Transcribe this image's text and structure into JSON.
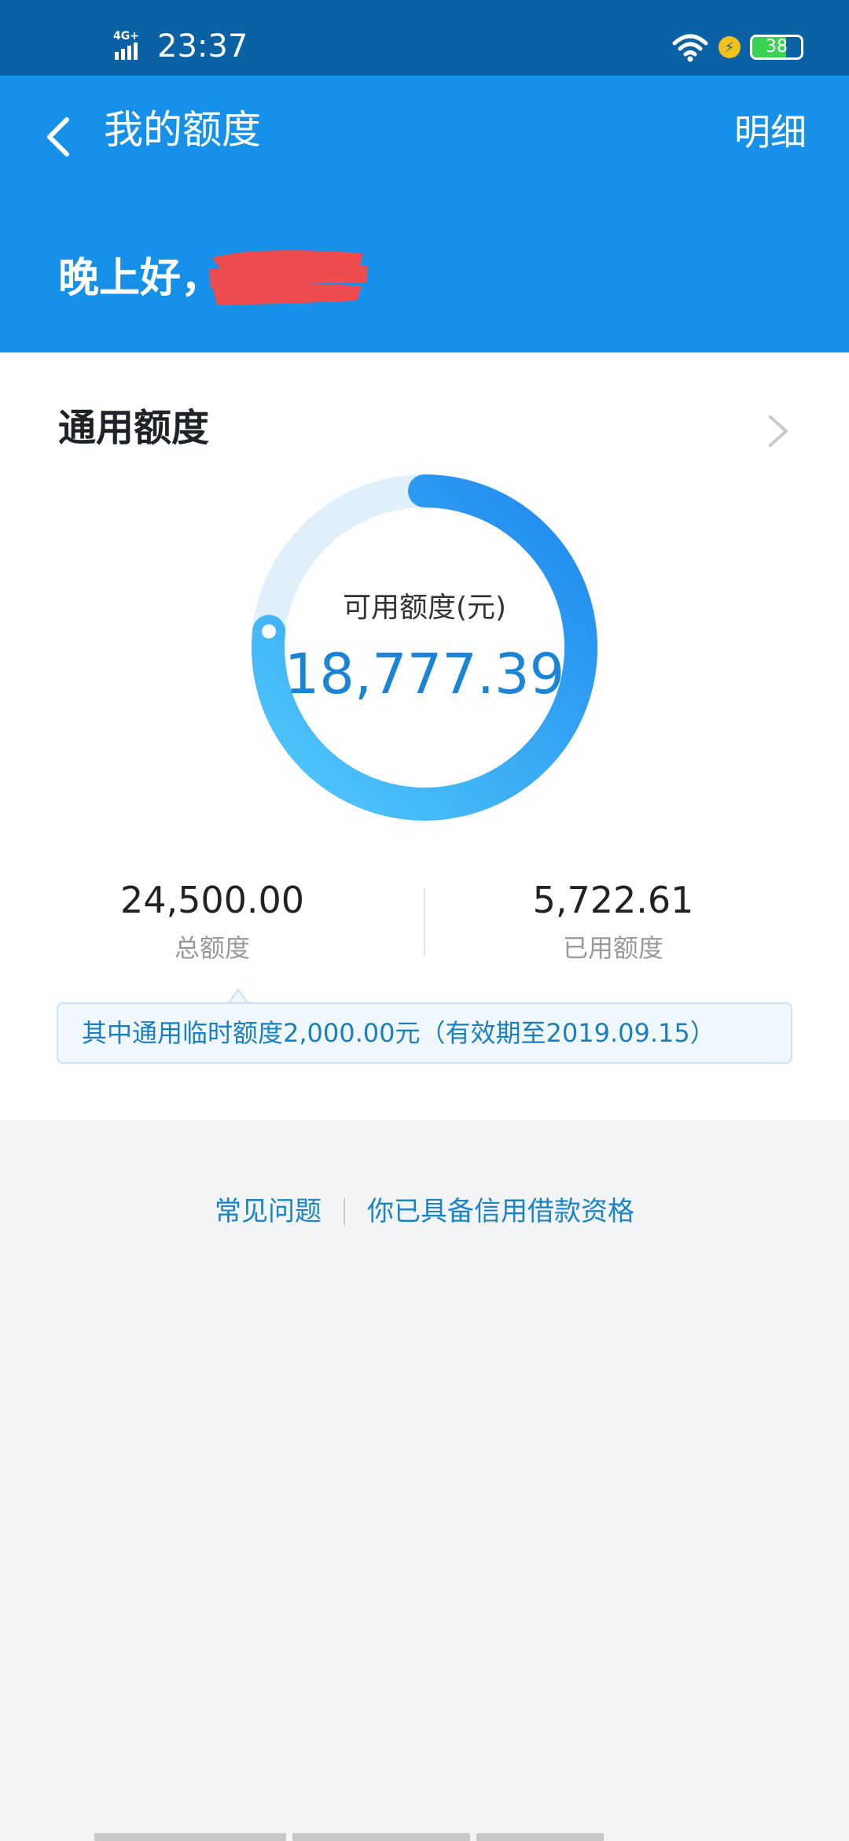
{
  "status_bar": {
    "network": "4G+",
    "time": "23:37",
    "battery": "38"
  },
  "nav": {
    "title": "我的额度",
    "action": "明细"
  },
  "greeting": "晚上好，",
  "credit": {
    "section_title": "通用额度",
    "available_label": "可用额度(元)",
    "available_value": "18,777.39",
    "used_fraction": 0.2336,
    "total_value": "24,500.00",
    "total_label": "总额度",
    "used_value": "5,722.61",
    "used_label": "已用额度",
    "notice": "其中通用临时额度2,000.00元（有效期至2019.09.15）"
  },
  "links": {
    "faq": "常见问题",
    "eligibility": "你已具备信用借款资格"
  },
  "colors": {
    "status_bar": "#0a61a3",
    "header": "#1690e8",
    "accent": "#1a84d6",
    "ring_track": "#dff0fb"
  }
}
